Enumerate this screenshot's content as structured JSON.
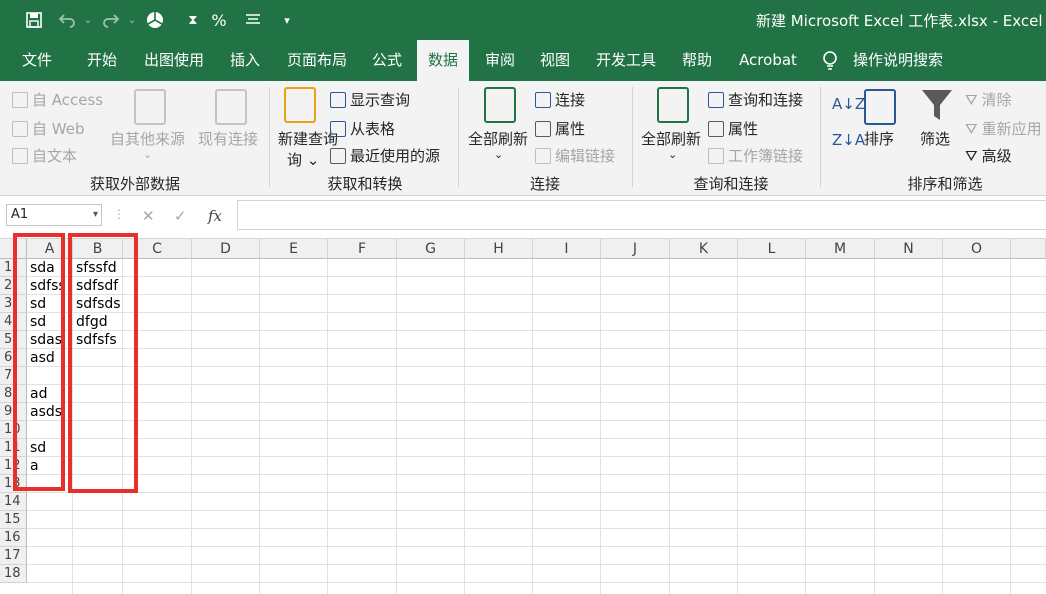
{
  "title_bar": {
    "title": "新建 Microsoft Excel 工作表.xlsx  -  Excel",
    "quick_access": [
      "save-icon",
      "undo-icon",
      "redo-icon",
      "pie-chart-icon",
      "sort-icon",
      "percent-icon",
      "align-icon",
      "customize-icon"
    ],
    "percent_label": "%"
  },
  "menu_tabs": [
    "文件",
    "开始",
    "出图使用",
    "插入",
    "页面布局",
    "公式",
    "数据",
    "审阅",
    "视图",
    "开发工具",
    "帮助",
    "Acrobat"
  ],
  "active_tab": "数据",
  "tell_me": "操作说明搜索",
  "ribbon": {
    "get_external": {
      "label": "获取外部数据",
      "from_access": "自 Access",
      "from_web": "自 Web",
      "from_text": "自文本",
      "other_sources": "自其他来源",
      "existing_connections": "现有连接"
    },
    "get_transform": {
      "label": "获取和转换",
      "new_query": "新建查询",
      "new_query_line2": "询 ⌄",
      "show_queries": "显示查询",
      "from_table": "从表格",
      "recent_sources": "最近使用的源"
    },
    "connections": {
      "label": "连接",
      "refresh_all": "全部刷新",
      "connections": "连接",
      "properties": "属性",
      "edit_links": "编辑链接"
    },
    "queries_connections": {
      "label": "查询和连接",
      "refresh_all": "全部刷新",
      "queries_connections": "查询和连接",
      "properties": "属性",
      "workbook_links": "工作簿链接"
    },
    "sort_filter": {
      "label": "排序和筛选",
      "sort": "排序",
      "filter": "筛选",
      "clear": "清除",
      "reapply": "重新应用",
      "advanced": "高级"
    }
  },
  "formula_bar": {
    "name_box": "A1",
    "cancel": "✕",
    "enter": "✓",
    "fx": "fx",
    "formula": ""
  },
  "grid": {
    "columns": [
      "A",
      "B",
      "C",
      "D",
      "E",
      "F",
      "G",
      "H",
      "I",
      "J",
      "K",
      "L",
      "M",
      "N",
      "O"
    ],
    "rows": [
      "1",
      "2",
      "3",
      "4",
      "5",
      "6",
      "7",
      "8",
      "9",
      "10",
      "11",
      "12",
      "13",
      "14",
      "15",
      "16",
      "17",
      "18"
    ],
    "col_a": [
      "sda",
      "sdfss",
      "sd",
      "sd",
      "sdas",
      "asd",
      "",
      "ad",
      "asds",
      "",
      "sd",
      "a",
      "",
      "",
      "",
      "",
      "",
      ""
    ],
    "col_b": [
      "sfssfd",
      "sdfsdf",
      "sdfsds",
      "dfgd",
      "sdfsfs",
      "",
      "",
      "",
      "",
      "",
      "",
      "",
      "",
      "",
      "",
      "",
      "",
      ""
    ]
  },
  "highlight_color": "#e8302a",
  "accent_color": "#217346"
}
